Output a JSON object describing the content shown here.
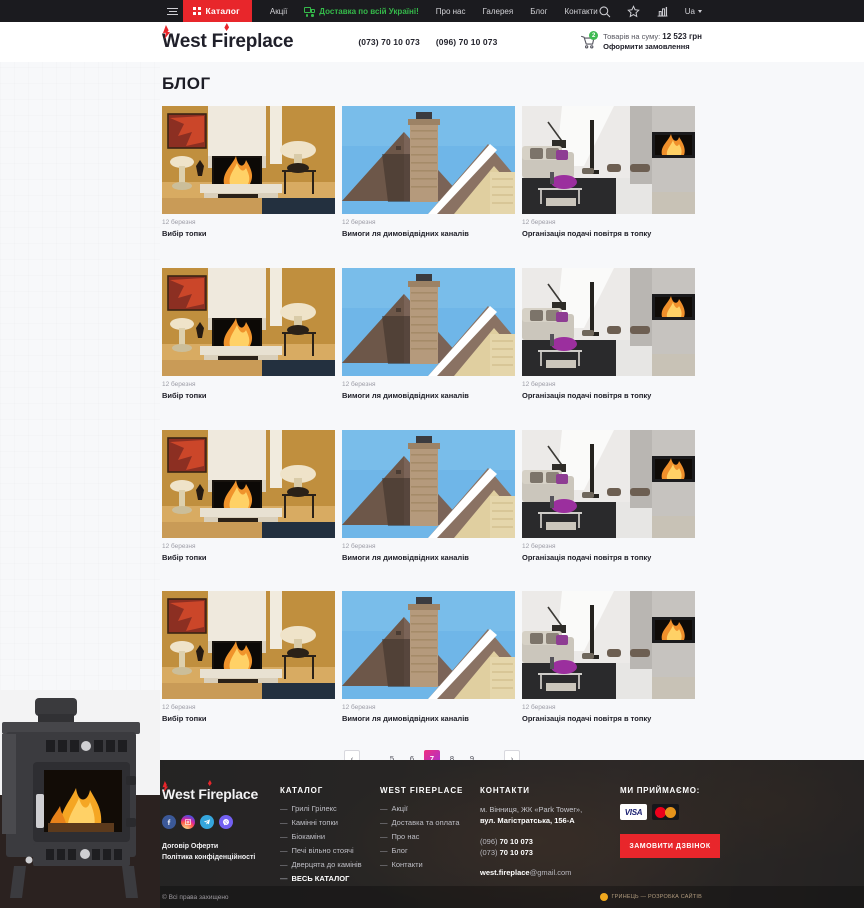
{
  "topbar": {
    "menu_icon": "burger-icon",
    "catalog_label": "Каталог",
    "nav": [
      {
        "label": "Акції",
        "type": "link"
      },
      {
        "label": "Доставка по всій Україні!",
        "type": "delivery"
      },
      {
        "label": "Про нас",
        "type": "link"
      },
      {
        "label": "Галерея",
        "type": "link"
      },
      {
        "label": "Блог",
        "type": "link"
      },
      {
        "label": "Контакти",
        "type": "link"
      }
    ],
    "icons": [
      "search-icon",
      "star-icon",
      "compare-icon"
    ],
    "language": "Ua"
  },
  "header": {
    "logo_first": "W",
    "logo_rest": "est F",
    "logo_tail": "replace",
    "logo_i": "i",
    "phones": [
      "(073) 70 10 073",
      "(096) 70 10 073"
    ],
    "cart": {
      "badge": "2",
      "amount_label": "Товарів на суму:",
      "amount": "12 523 грн",
      "checkout_label": "Оформити замовлення"
    }
  },
  "main": {
    "page_title": "БЛОГ",
    "posts": [
      {
        "date": "12 березня",
        "title": "Вибір топки",
        "image": "fireplace-interior"
      },
      {
        "date": "12 березня",
        "title": "Вимоги ля димовідвідних каналів",
        "image": "chimney-roof"
      },
      {
        "date": "12 березня",
        "title": "Організація подачі повітря в топку",
        "image": "modern-living-room"
      },
      {
        "date": "12 березня",
        "title": "Вибір топки",
        "image": "fireplace-interior"
      },
      {
        "date": "12 березня",
        "title": "Вимоги ля димовідвідних каналів",
        "image": "chimney-roof"
      },
      {
        "date": "12 березня",
        "title": "Організація подачі повітря в топку",
        "image": "modern-living-room"
      },
      {
        "date": "12 березня",
        "title": "Вибір топки",
        "image": "fireplace-interior"
      },
      {
        "date": "12 березня",
        "title": "Вимоги ля димовідвідних каналів",
        "image": "chimney-roof"
      },
      {
        "date": "12 березня",
        "title": "Організація подачі повітря в топку",
        "image": "modern-living-room"
      },
      {
        "date": "12 березня",
        "title": "Вибір топки",
        "image": "fireplace-interior"
      },
      {
        "date": "12 березня",
        "title": "Вимоги ля димовідвідних каналів",
        "image": "chimney-roof"
      },
      {
        "date": "12 березня",
        "title": "Організація подачі повітря в топку",
        "image": "modern-living-room"
      }
    ]
  },
  "pagination": {
    "prev": "‹",
    "next": "›",
    "items": [
      "..",
      "5",
      "6",
      "7",
      "8",
      "9",
      ".."
    ],
    "active": "7",
    "active_color": "#f0317f"
  },
  "footer": {
    "logo_first": "W",
    "logo_rest": "est F",
    "logo_i": "i",
    "logo_tail": "replace",
    "socials": [
      "facebook-icon",
      "instagram-icon",
      "telegram-icon",
      "viber-icon"
    ],
    "links": [
      "Договір Оферти",
      "Політика конфіденційності"
    ],
    "catalog": {
      "title": "КАТАЛОГ",
      "items": [
        "Грилі Грілекс",
        "Камінні топки",
        "Біокаміни",
        "Печі вільно стоячі",
        "Дверцята до камінів",
        "ВЕСЬ КАТАЛОГ"
      ],
      "strong_item": "ВЕСЬ КАТАЛОГ"
    },
    "about": {
      "title": "WEST FIREPLACE",
      "items": [
        "Акції",
        "Доставка та оплата",
        "Про нас",
        "Блог",
        "Контакти"
      ]
    },
    "contacts": {
      "title": "КОНТАКТИ",
      "address_line1": "м. Вінниця, ЖК «Park Tower»,",
      "address_line2": "вул. Магістратська, 156-А",
      "phone1_code": "(096)",
      "phone1": "70 10 073",
      "phone2_code": "(073)",
      "phone2": "70 10 073",
      "email_user": "west.fireplace",
      "email_domain": "@gmail.com"
    },
    "payments": {
      "title": "МИ ПРИЙМАЄМО:",
      "cards": [
        "VISA",
        "MasterCard"
      ],
      "callback_label": "ЗАМОВИТИ ДЗВІНОК"
    },
    "bottom": {
      "copyright": "© Всі права захищено",
      "developer": "ГРИНЕЦЬ — РОЗРОБКА САЙТІВ"
    }
  }
}
